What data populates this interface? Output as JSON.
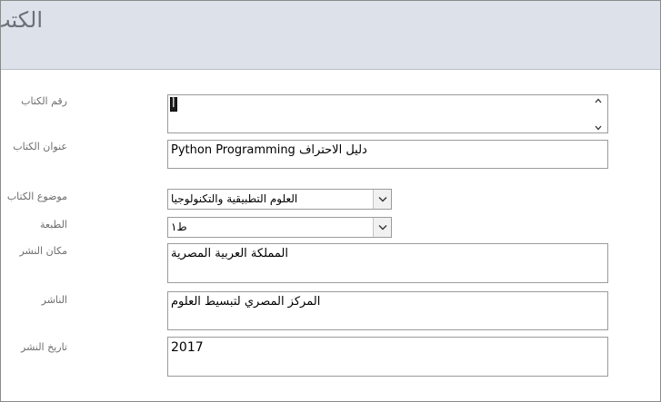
{
  "header": {
    "title": "الكتب"
  },
  "form": {
    "book_number": {
      "label": "رقم الكتاب",
      "value": "أ"
    },
    "book_title": {
      "label": "عنوان الكتاب",
      "value": "دليل الاحتراف Python Programming"
    },
    "subject": {
      "label": "موضوع الكتاب",
      "value": "العلوم التطبيقية والتكنولوجيا"
    },
    "edition": {
      "label": "الطبعة",
      "value": "ط١"
    },
    "publish_place": {
      "label": "مكان النشر",
      "value": "المملكة العربية المصرية"
    },
    "publisher": {
      "label": "الناشر",
      "value": "المركز المصري لتبسيط العلوم"
    },
    "publish_date": {
      "label": "تاريخ النشر",
      "value": "2017"
    }
  },
  "icons": {
    "spin_up": "▲",
    "spin_down": "▼",
    "dropdown": "chevron-down-icon"
  }
}
